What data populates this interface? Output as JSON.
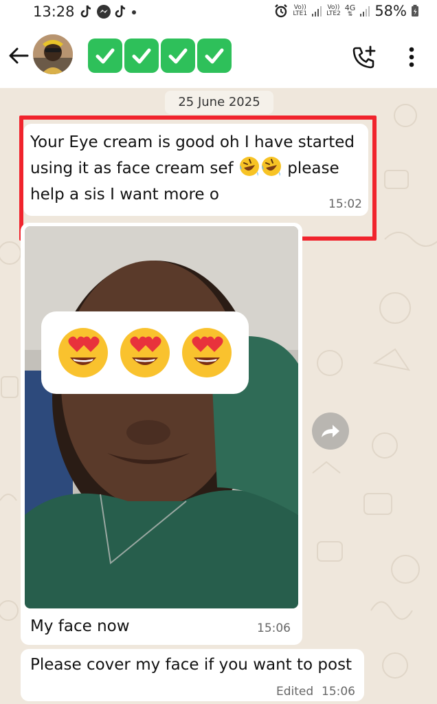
{
  "status_bar": {
    "time": "13:28",
    "battery": "58%",
    "sim1": "LTE1",
    "sim2": "LTE2",
    "network": "4G",
    "volte": "Vo))"
  },
  "header": {
    "back_icon": "arrow-left-icon",
    "contact_name_icons": [
      "check-mark-button-emoji",
      "check-mark-button-emoji",
      "check-mark-button-emoji",
      "check-mark-button-emoji"
    ],
    "add_call_icon": "phone-plus-icon",
    "menu_icon": "more-vertical-icon"
  },
  "chat": {
    "date_divider": "25 June 2025",
    "messages": [
      {
        "text_line1": "Your Eye cream is good oh  I have started",
        "text_line2a": "using it as face cream sef",
        "text_line2b": "please",
        "text_line3": "help a sis I want more o",
        "time": "15:02",
        "emojis": [
          "rolling-on-floor-laughing-emoji",
          "rolling-on-floor-laughing-emoji"
        ]
      },
      {
        "caption": "My face now",
        "time": "15:06",
        "image": "selfie-photo",
        "cover_emojis": [
          "heart-eyes-emoji",
          "heart-eyes-emoji",
          "heart-eyes-emoji"
        ]
      },
      {
        "text": "Please cover my face if you want to post",
        "edited_label": "Edited",
        "time": "15:06"
      }
    ],
    "forward_icon": "forward-icon"
  },
  "colors": {
    "chat_background": "#efe7dc",
    "bubble": "#ffffff",
    "highlight_border": "#f0242d",
    "check_green": "#2ec05a"
  }
}
